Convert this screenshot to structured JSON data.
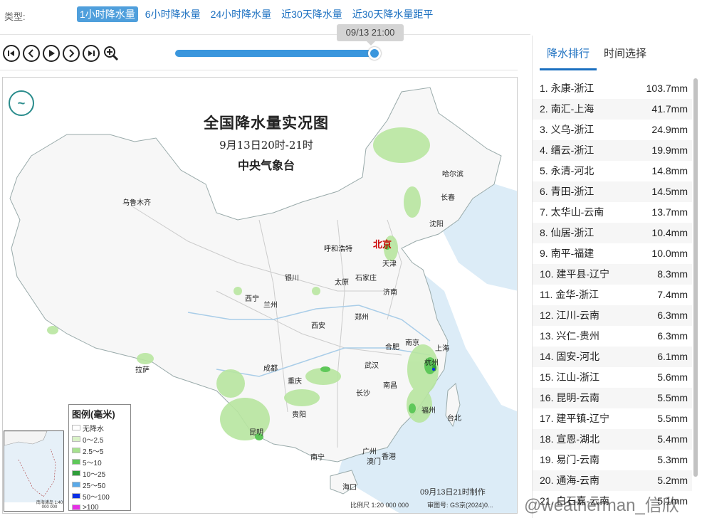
{
  "type_bar": {
    "label": "类型:",
    "tabs": [
      "1小时降水量",
      "6小时降水量",
      "24小时降水量",
      "近30天降水量",
      "近30天降水量距平"
    ],
    "active_index": 0
  },
  "playback": {
    "time_tooltip": "09/13 21:00",
    "progress": 1.0
  },
  "map": {
    "title": "全国降水量实况图",
    "subtitle": "9月13日20时-21时",
    "agency": "中央气象台",
    "capital": "北京",
    "cities": [
      "乌鲁木齐",
      "哈尔滨",
      "长春",
      "沈阳",
      "呼和浩特",
      "天津",
      "石家庄",
      "太原",
      "银川",
      "西宁",
      "兰州",
      "济南",
      "郑州",
      "西安",
      "合肥",
      "南京",
      "上海",
      "杭州",
      "拉萨",
      "成都",
      "重庆",
      "武汉",
      "南昌",
      "长沙",
      "福州",
      "台北",
      "贵阳",
      "昆明",
      "南宁",
      "广州",
      "澳门",
      "香港",
      "海口"
    ],
    "legend": {
      "title": "图例(毫米)",
      "items": [
        {
          "label": "无降水",
          "color": "#ffffff"
        },
        {
          "label": "0～2.5",
          "color": "#d9f2c7"
        },
        {
          "label": "2.5～5",
          "color": "#a6e28e"
        },
        {
          "label": "5～10",
          "color": "#5fc85a"
        },
        {
          "label": "10～25",
          "color": "#2f9e3a"
        },
        {
          "label": "25～50",
          "color": "#5aa9e8"
        },
        {
          "label": "50～100",
          "color": "#0a2fe6"
        },
        {
          "label": ">100",
          "color": "#e62fe6"
        }
      ]
    },
    "made_at": "09月13日21时制作",
    "scale": "比例尺 1:20 000 000",
    "review_no": "审图号: GS京(2024)0...",
    "inset_label": "南海诸岛 1:40 000 000"
  },
  "panel": {
    "tabs": [
      "降水排行",
      "时间选择"
    ],
    "active_tab": 0,
    "ranking": [
      {
        "name": "1. 永康-浙江",
        "value": "103.7mm"
      },
      {
        "name": "2. 南汇-上海",
        "value": "41.7mm"
      },
      {
        "name": "3. 义乌-浙江",
        "value": "24.9mm"
      },
      {
        "name": "4. 缙云-浙江",
        "value": "19.9mm"
      },
      {
        "name": "5. 永清-河北",
        "value": "14.8mm"
      },
      {
        "name": "6. 青田-浙江",
        "value": "14.5mm"
      },
      {
        "name": "7. 太华山-云南",
        "value": "13.7mm"
      },
      {
        "name": "8. 仙居-浙江",
        "value": "10.4mm"
      },
      {
        "name": "9. 南平-福建",
        "value": "10.0mm"
      },
      {
        "name": "10. 建平县-辽宁",
        "value": "8.3mm"
      },
      {
        "name": "11. 金华-浙江",
        "value": "7.4mm"
      },
      {
        "name": "12. 江川-云南",
        "value": "6.3mm"
      },
      {
        "name": "13. 兴仁-贵州",
        "value": "6.3mm"
      },
      {
        "name": "14. 固安-河北",
        "value": "6.1mm"
      },
      {
        "name": "15. 江山-浙江",
        "value": "5.6mm"
      },
      {
        "name": "16. 昆明-云南",
        "value": "5.5mm"
      },
      {
        "name": "17. 建平镇-辽宁",
        "value": "5.5mm"
      },
      {
        "name": "18. 宣恩-湖北",
        "value": "5.4mm"
      },
      {
        "name": "19. 易门-云南",
        "value": "5.3mm"
      },
      {
        "name": "20. 通海-云南",
        "value": "5.2mm"
      },
      {
        "name": "21. 白石嘉-云南",
        "value": "5.1mm"
      }
    ]
  },
  "watermark": "@weatherman_信欣"
}
